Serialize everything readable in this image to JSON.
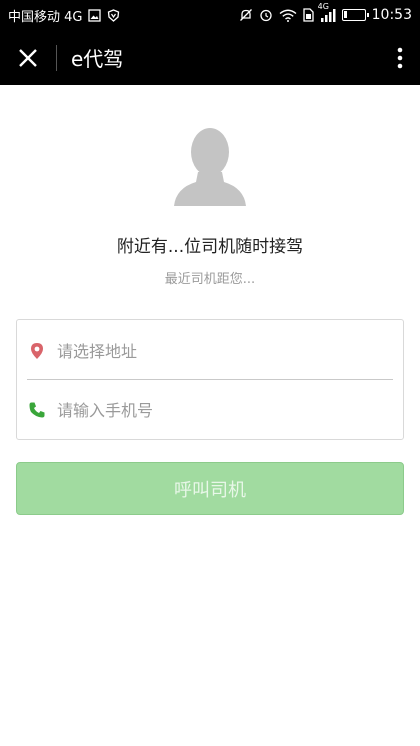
{
  "status_bar": {
    "carrier": "中国移动 4G",
    "network_label": "4G",
    "time": "10:53",
    "battery_level": 0.15
  },
  "title_bar": {
    "title": "e代驾"
  },
  "main": {
    "headline": "附近有...位司机随时接驾",
    "subline": "最近司机距您...",
    "address_placeholder": "请选择地址",
    "phone_placeholder": "请输入手机号",
    "call_button_label": "呼叫司机"
  },
  "colors": {
    "accent_green": "#a1dba0",
    "location_pin": "#d9646a",
    "phone_icon": "#3aa63a"
  }
}
